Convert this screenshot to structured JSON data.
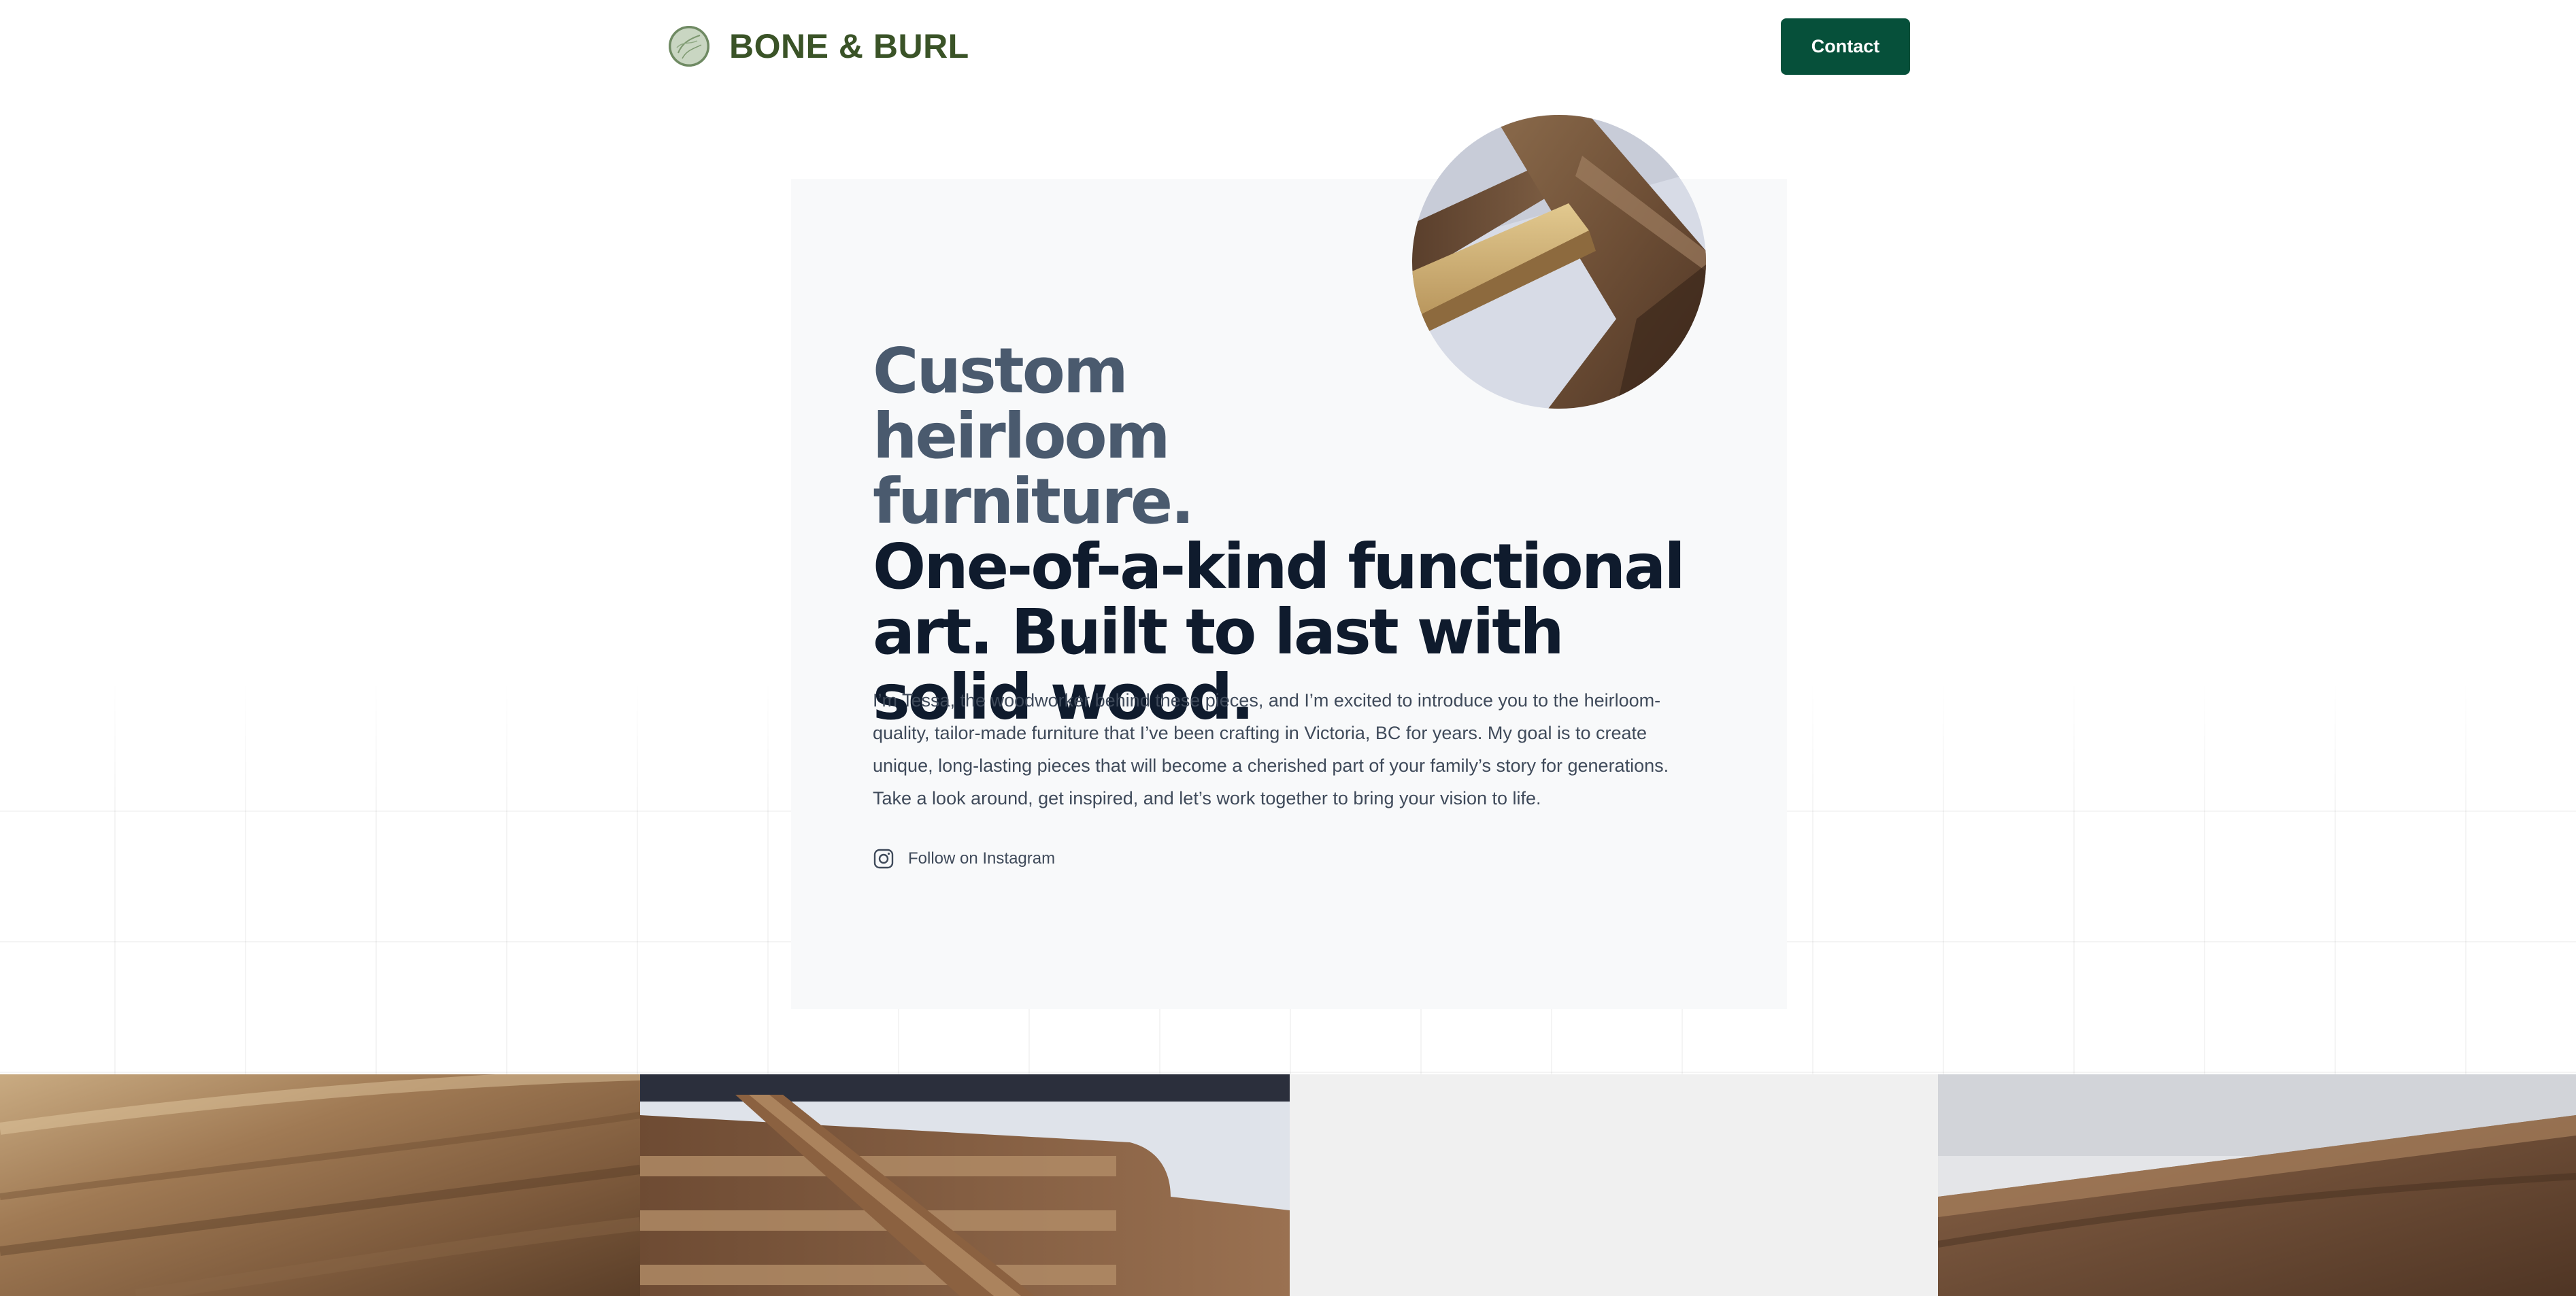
{
  "header": {
    "brand_name": "BONE & BURL",
    "logo_icon": "burl-wood-logo-icon",
    "contact_label": "Contact",
    "brand_color": "#3a5327",
    "button_color": "#06503a"
  },
  "hero": {
    "headline_lead": "Custom heirloom furniture.",
    "headline_main": "One-of-a-kind functional art. Built to last with solid wood.",
    "intro": "I’m Tessa, the woodworker behind these pieces, and I’m excited to introduce you to the heirloom-quality, tailor-made furniture that I’ve been crafting in Victoria, BC for years. My goal is to create unique, long-lasting pieces that will become a cherished part of your family’s story for generations. Take a look around, get inspired, and let’s work together to bring your vision to life.",
    "instagram_label": "Follow on Instagram",
    "instagram_icon": "instagram-icon",
    "photo_icon": "wood-joinery-photo"
  },
  "gallery": {
    "tiles": [
      {
        "name": "walnut-grain-closeup"
      },
      {
        "name": "walnut-slat-chair"
      },
      {
        "name": "blank-placeholder"
      },
      {
        "name": "walnut-tabletop-edge"
      }
    ]
  }
}
